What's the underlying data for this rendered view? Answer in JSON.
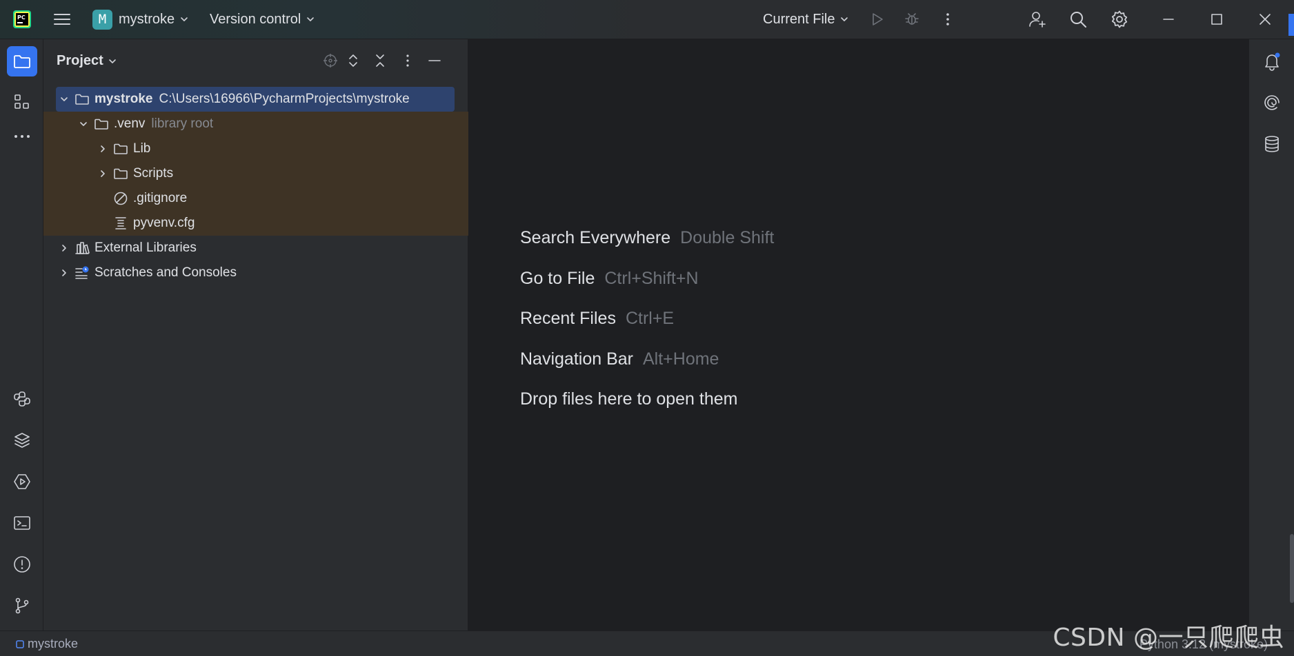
{
  "titlebar": {
    "app_logo": "pycharm-logo",
    "project_badge": "M",
    "project_name": "mystroke",
    "version_control": "Version control",
    "run_config": "Current File"
  },
  "left_toolbar": {
    "items": [
      "project-folder-icon",
      "structure-icon",
      "more-icon",
      "python-console-icon",
      "layers-icon",
      "services-icon",
      "terminal-icon",
      "problems-icon",
      "git-icon"
    ]
  },
  "right_toolbar": {
    "items": [
      "notifications-icon",
      "ai-assistant-icon",
      "database-icon"
    ]
  },
  "project_panel": {
    "title": "Project",
    "tree": [
      {
        "name": "mystroke",
        "extra": "C:\\Users\\16966\\PycharmProjects\\mystroke"
      },
      {
        "name": ".venv",
        "extra": "library root"
      },
      {
        "name": "Lib"
      },
      {
        "name": "Scripts"
      },
      {
        "name": ".gitignore"
      },
      {
        "name": "pyvenv.cfg"
      },
      {
        "name": "External Libraries"
      },
      {
        "name": "Scratches and Consoles"
      }
    ]
  },
  "editor": {
    "hints": [
      {
        "label": "Search Everywhere",
        "shortcut": "Double Shift"
      },
      {
        "label": "Go to File",
        "shortcut": "Ctrl+Shift+N"
      },
      {
        "label": "Recent Files",
        "shortcut": "Ctrl+E"
      },
      {
        "label": "Navigation Bar",
        "shortcut": "Alt+Home"
      },
      {
        "label": "Drop files here to open them",
        "shortcut": ""
      }
    ]
  },
  "statusbar": {
    "project": "mystroke",
    "interpreter": "Python 3.12 (mystroke)"
  },
  "watermark": "CSDN @一只爬爬虫",
  "colors": {
    "accent": "#3574f0",
    "selection": "#2e436e",
    "library_root_bg": "#3e3325",
    "editor_bg": "#1e1f22",
    "panel_bg": "#2b2d30"
  }
}
